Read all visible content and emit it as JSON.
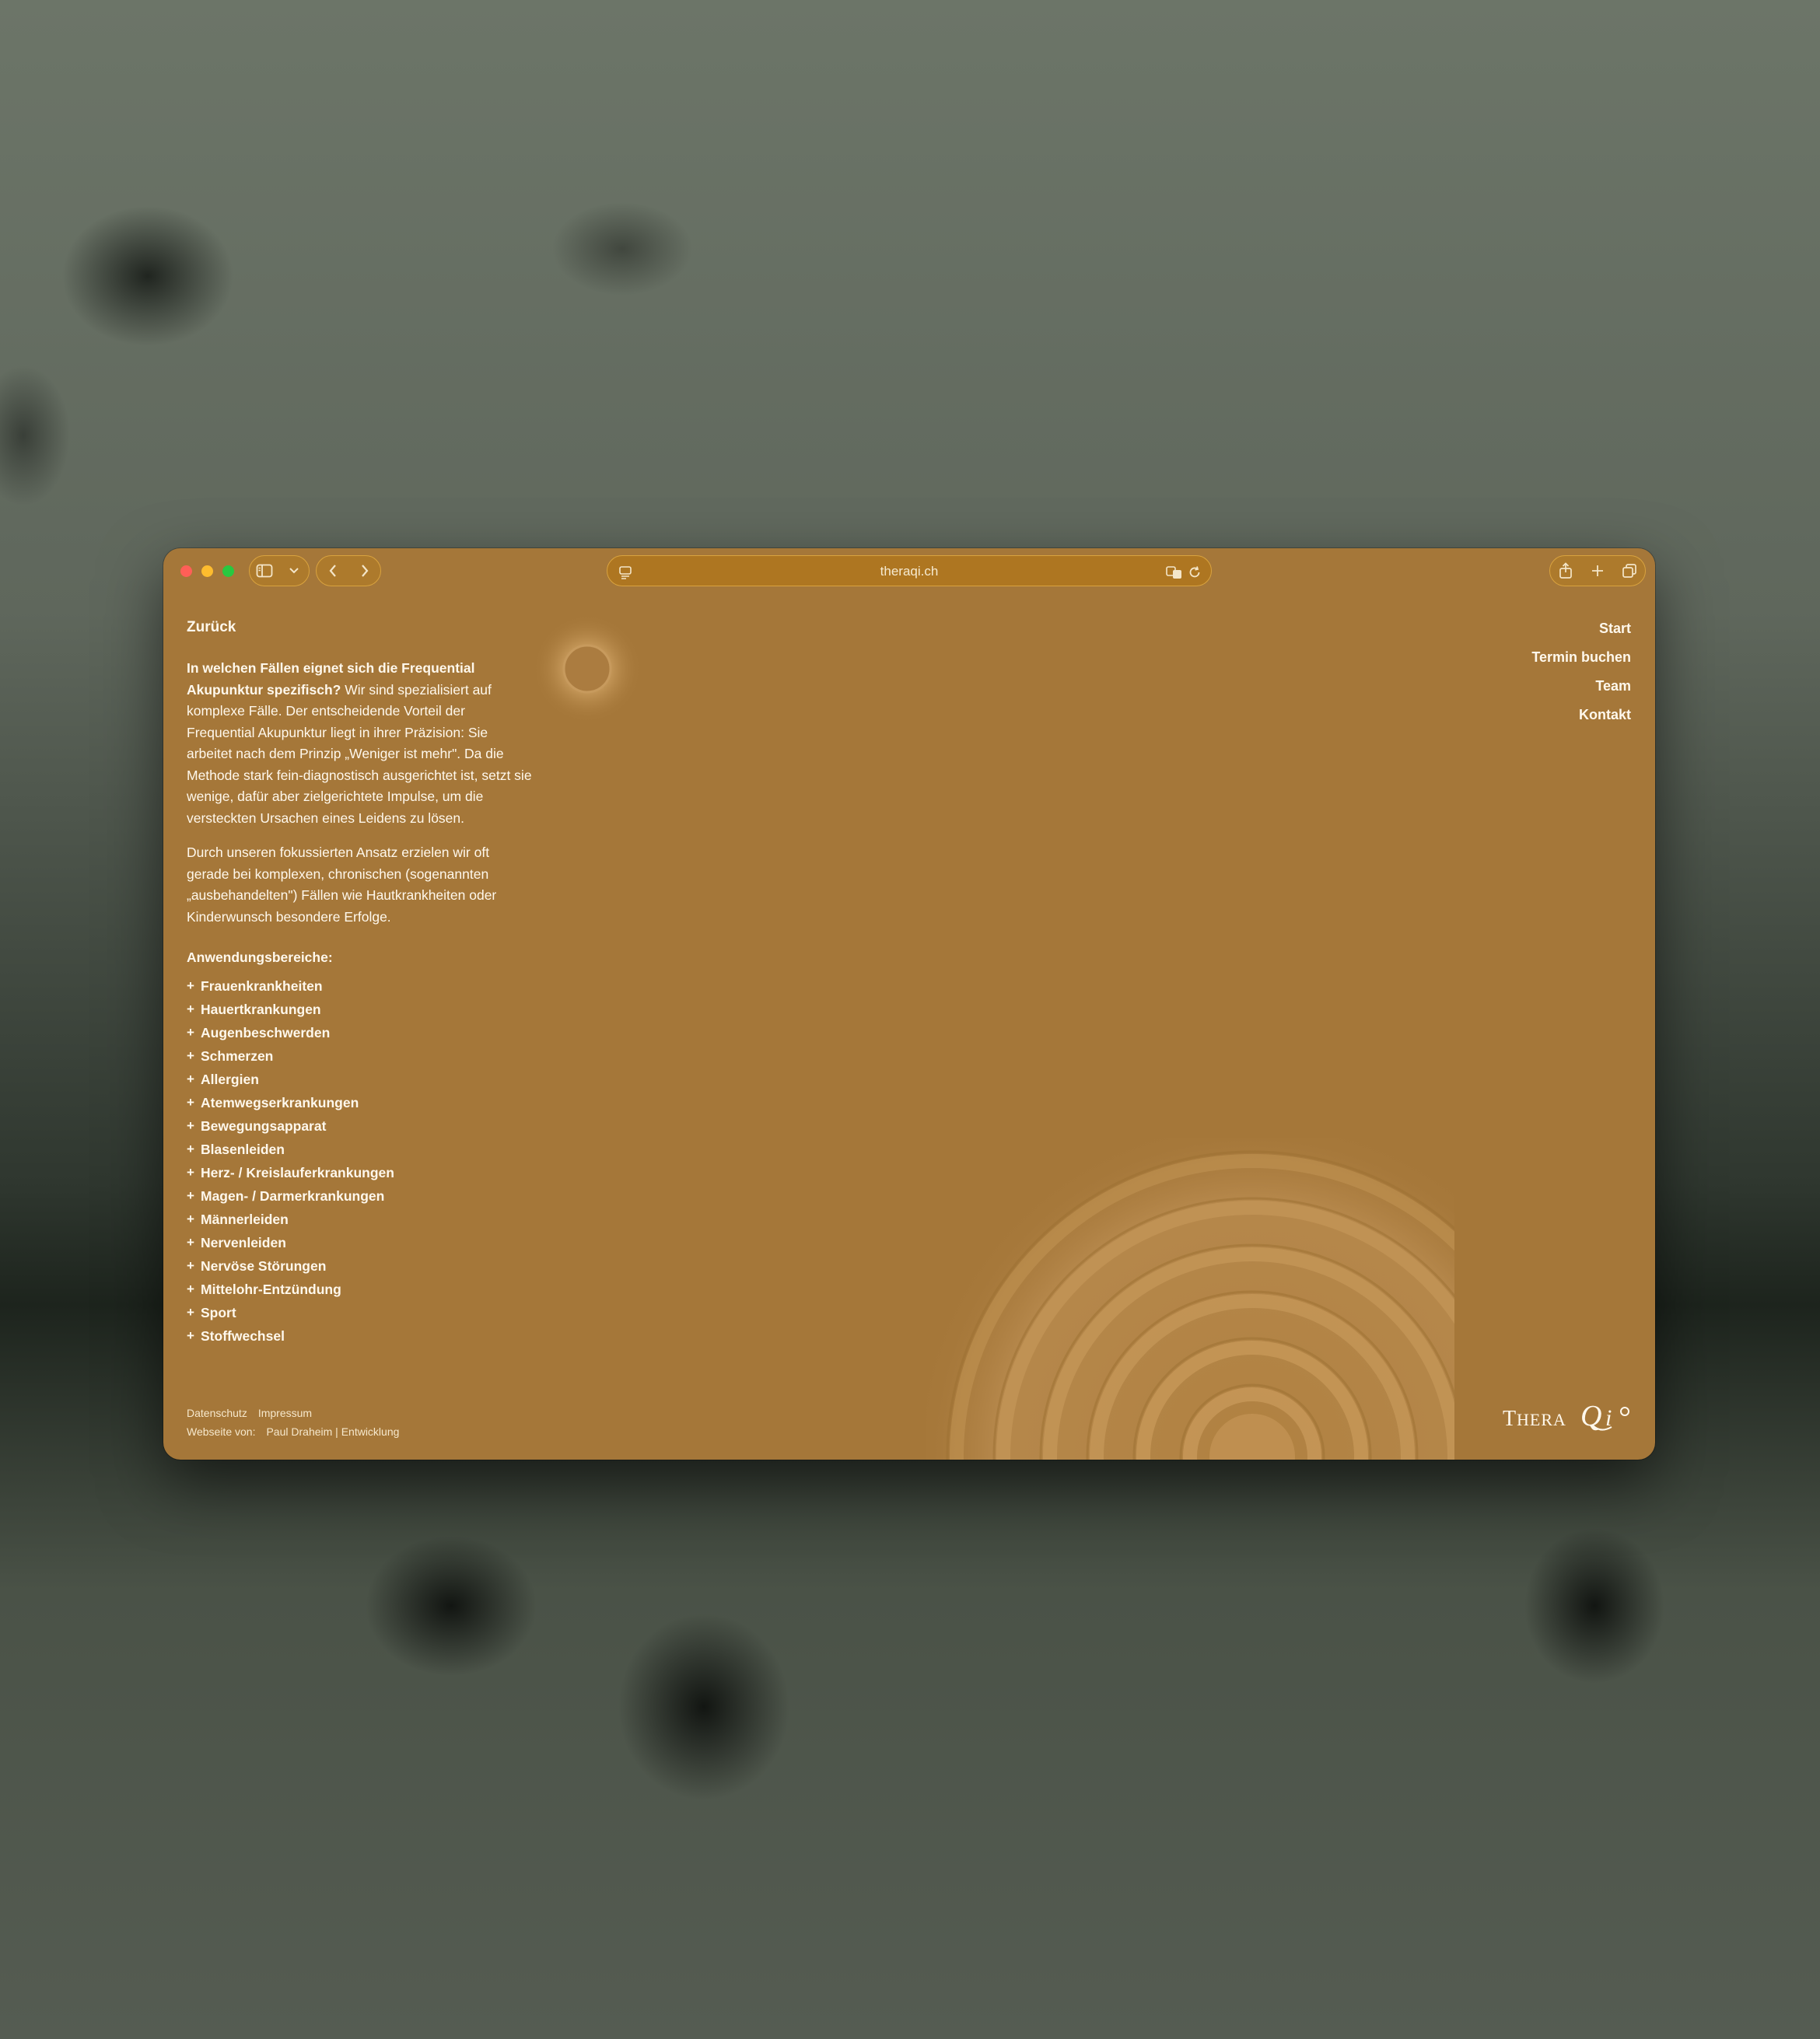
{
  "browser": {
    "url": "theraqi.ch",
    "icons": {
      "sidebar": "sidebar-icon",
      "chevron": "chevron-down-icon",
      "back": "back-arrow-icon",
      "forward": "forward-arrow-icon",
      "site_settings": "page-settings-icon",
      "translate": "translate-icon",
      "reload": "reload-icon",
      "share": "share-icon",
      "new_tab": "plus-icon",
      "tabs": "tabs-overview-icon"
    }
  },
  "page": {
    "back_label": "Zurück",
    "intro_question": "In welchen Fällen eignet sich die Frequential Akupunktur spezifisch?",
    "intro_text": " Wir sind spezialisiert auf komplexe Fälle. Der entscheidende Vorteil der Frequential Akupunktur liegt in ihrer Präzision: Sie arbeitet nach dem Prinzip „Weniger ist mehr\". Da die Methode stark fein-diagnostisch ausgerichtet ist, setzt sie wenige, dafür aber zielgerichtete Impulse, um die versteckten Ursachen eines Leidens zu lösen.",
    "paragraph2": "Durch unseren fokussierten Ansatz erzielen wir oft gerade bei komplexen, chronischen (sogenannten „ausbehandelten\") Fällen wie Hautkrankheiten oder Kinderwunsch besondere Erfolge.",
    "areas_title": "Anwendungsbereiche:",
    "areas": [
      "Frauenkrankheiten",
      "Hauertkrankungen",
      "Augenbeschwerden",
      "Schmerzen",
      "Allergien",
      "Atemwegserkrankungen",
      "Bewegungsapparat",
      "Blasenleiden",
      "Herz- / Kreislauferkrankungen",
      "Magen- / Darmerkrankungen",
      "Männerleiden",
      "Nervenleiden",
      "Nervöse Störungen",
      "Mittelohr-Entzündung",
      "Sport",
      "Stoffwechsel"
    ],
    "nav": [
      "Start",
      "Termin buchen",
      "Team",
      "Kontakt"
    ],
    "footer": {
      "privacy": "Datenschutz",
      "imprint": "Impressum",
      "credit_label": "Webseite von:",
      "credit_name": "Paul Draheim | Entwicklung"
    },
    "logo_text": "THERAQi"
  },
  "colors": {
    "page_bg": "#a57739",
    "accent": "#d9a33f",
    "text": "#fff8ec"
  }
}
